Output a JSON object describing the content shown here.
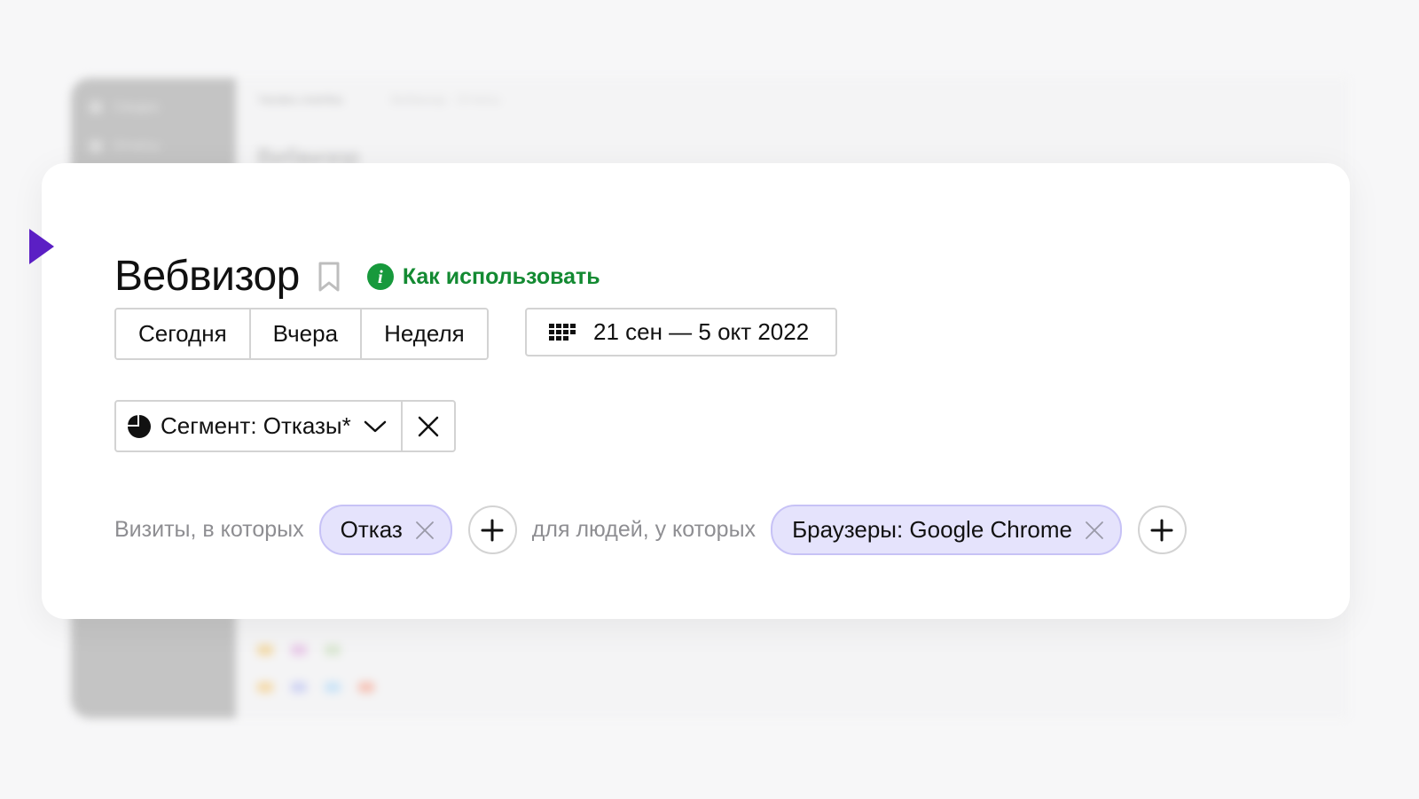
{
  "background": {
    "sidebar": {
      "items": [
        "Сводка",
        "Отчеты"
      ]
    },
    "header": {
      "counter": "Yandex.metrika",
      "breadcrumb": "Вебвизор · Отчеты"
    },
    "title": "Вебвизор"
  },
  "card": {
    "title": "Вебвизор",
    "howto_label": "Как использовать",
    "periods": [
      "Сегодня",
      "Вчера",
      "Неделя"
    ],
    "date_range": "21 сен — 5 окт 2022",
    "segment_label": "Сегмент: Отказы*",
    "filters": {
      "visits_text": "Визиты, в которых",
      "visits_pill": "Отказ",
      "people_text": "для людей, у которых",
      "people_pill": "Браузеры: Google Chrome"
    }
  },
  "colors": {
    "accent_green": "#138a32",
    "pill_bg": "#e5e3fc",
    "marker_purple": "#5b1fc4"
  },
  "icons": [
    "bookmark-icon",
    "info-icon",
    "calendar-icon",
    "pie-chart-icon",
    "chevron-down-icon",
    "close-icon",
    "plus-icon"
  ]
}
